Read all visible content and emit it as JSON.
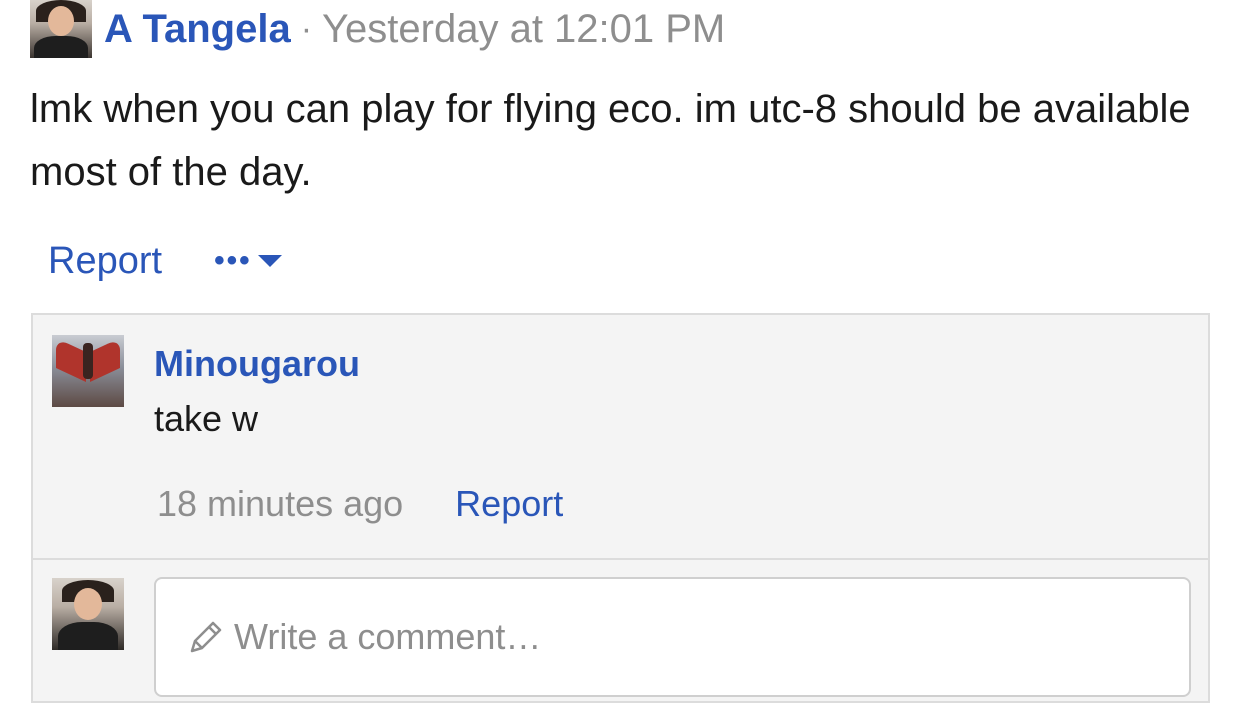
{
  "post": {
    "author": "A Tangela",
    "separator": "·",
    "timestamp": "Yesterday at 12:01 PM",
    "text": "lmk when you can play for flying eco. im utc-8 should be available most of the day.",
    "report_label": "Report",
    "more_label": "•••"
  },
  "reply": {
    "author": "Minougarou",
    "text": "take w",
    "time": "18 minutes ago",
    "report_label": "Report"
  },
  "composer": {
    "placeholder": "Write a comment…"
  },
  "colors": {
    "link": "#2a56b8",
    "muted": "#8e8e8e",
    "panel_bg": "#f4f4f4"
  }
}
